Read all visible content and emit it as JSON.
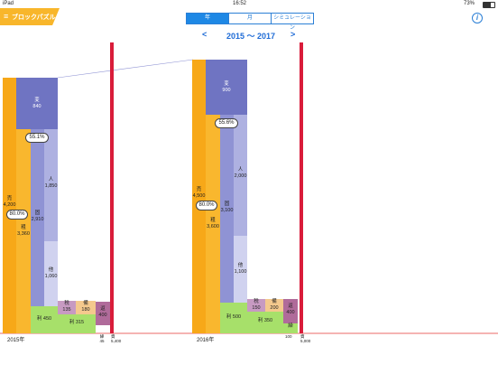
{
  "status": {
    "device": "iPad",
    "time": "16:52",
    "battery": "73%"
  },
  "app": {
    "menu_icon": "hamburger-icon",
    "title": "ブロックパズル"
  },
  "segments": [
    {
      "label": "年",
      "active": true
    },
    {
      "label": "月",
      "active": false
    },
    {
      "label": "シミュレーション",
      "active": false
    }
  ],
  "info_icon": "info-icon",
  "nav": {
    "prev": "<",
    "next": ">",
    "range": "2015 〜 2017"
  },
  "years": [
    {
      "year_label": "2015年",
      "blocks": {
        "sales": {
          "name": "売",
          "value": "4,200"
        },
        "gross": {
          "name": "粗",
          "value": "3,360"
        },
        "variable": {
          "name": "変",
          "value": "840"
        },
        "fixed": {
          "name": "固",
          "value": "2,910"
        },
        "personnel": {
          "name": "人",
          "value": "1,850"
        },
        "other": {
          "name": "他",
          "value": "1,060"
        },
        "profit": {
          "name": "利",
          "value": "450"
        },
        "profit2": {
          "name": "利",
          "value": "315"
        },
        "tax": {
          "name": "税",
          "value": "135"
        },
        "reserve": {
          "name": "備",
          "value": "180"
        },
        "debt": {
          "name": "返",
          "value": "400"
        },
        "remain": {
          "name": "繰",
          "value": "45"
        },
        "assets": {
          "name": "資",
          "value": "5,400"
        }
      },
      "ratios": {
        "gross_ratio": "80.0%",
        "labor_ratio": "55.1%"
      }
    },
    {
      "year_label": "2016年",
      "blocks": {
        "sales": {
          "name": "売",
          "value": "4,500"
        },
        "gross": {
          "name": "粗",
          "value": "3,600"
        },
        "variable": {
          "name": "変",
          "value": "900"
        },
        "fixed": {
          "name": "固",
          "value": "3,100"
        },
        "personnel": {
          "name": "人",
          "value": "2,000"
        },
        "other": {
          "name": "他",
          "value": "1,100"
        },
        "profit": {
          "name": "利",
          "value": "500"
        },
        "profit2": {
          "name": "利",
          "value": "350"
        },
        "tax": {
          "name": "税",
          "value": "150"
        },
        "reserve": {
          "name": "備",
          "value": "200"
        },
        "debt": {
          "name": "返",
          "value": "400"
        },
        "remain": {
          "name": "繰",
          "value": "100"
        },
        "assets": {
          "name": "資",
          "value": "5,000"
        }
      },
      "ratios": {
        "gross_ratio": "80.0%",
        "labor_ratio": "55.6%"
      }
    }
  ],
  "colors": {
    "sales": "#f7a818",
    "gross": "#f9b72e",
    "variable": "#6f74c2",
    "fixed": "#8f93d4",
    "personnel": "#aeb1e1",
    "other": "#d0d2ef",
    "profit": "#a7e06a",
    "tax": "#c79ac2",
    "reserve": "#f4c98d",
    "debt": "#b06b9a",
    "asset_bar": "#d91c3a",
    "baseline": "#e53935"
  }
}
